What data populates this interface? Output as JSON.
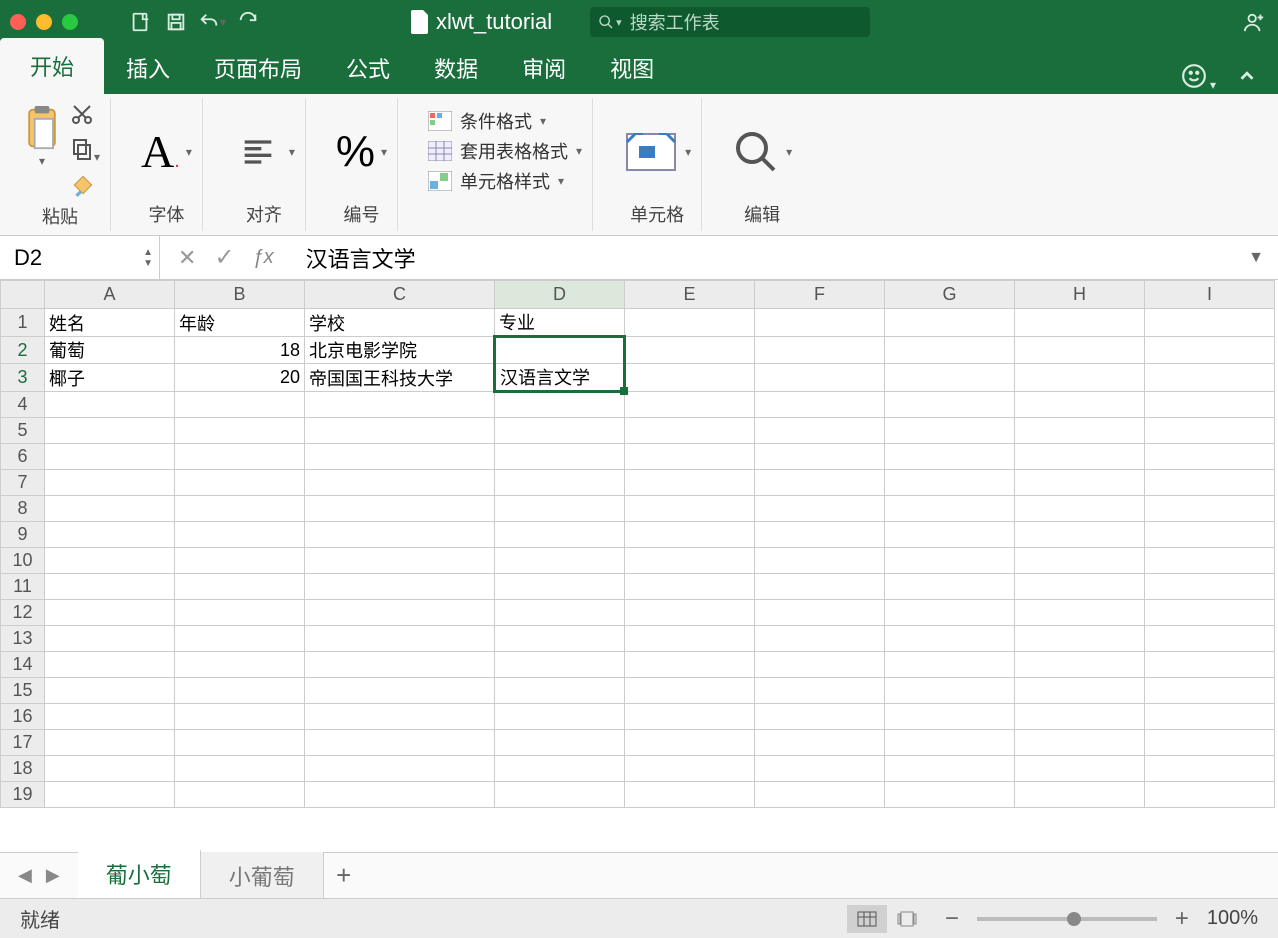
{
  "title": "xlwt_tutorial",
  "search_placeholder": "搜索工作表",
  "tabs": [
    "开始",
    "插入",
    "页面布局",
    "公式",
    "数据",
    "审阅",
    "视图"
  ],
  "active_tab": 0,
  "ribbon": {
    "paste": "粘贴",
    "font": "字体",
    "align": "对齐",
    "number": "编号",
    "cond_format": "条件格式",
    "table_format": "套用表格格式",
    "cell_style": "单元格样式",
    "cells": "单元格",
    "edit": "编辑"
  },
  "name_box": "D2",
  "formula": "汉语言文学",
  "columns": [
    "A",
    "B",
    "C",
    "D",
    "E",
    "F",
    "G",
    "H",
    "I"
  ],
  "row_count": 19,
  "cells": {
    "A1": "姓名",
    "B1": "年龄",
    "C1": "学校",
    "D1": "专业",
    "A2": "葡萄",
    "B2": "18",
    "C2": "北京电影学院",
    "A3": "椰子",
    "B3": "20",
    "C3": "帝国国王科技大学",
    "D3": "汉语言文学"
  },
  "selected_cell": "D2",
  "selection_span_rows": [
    2,
    3
  ],
  "sheets": [
    "葡小萄",
    "小葡萄"
  ],
  "active_sheet": 0,
  "status": "就绪",
  "zoom": "100%"
}
